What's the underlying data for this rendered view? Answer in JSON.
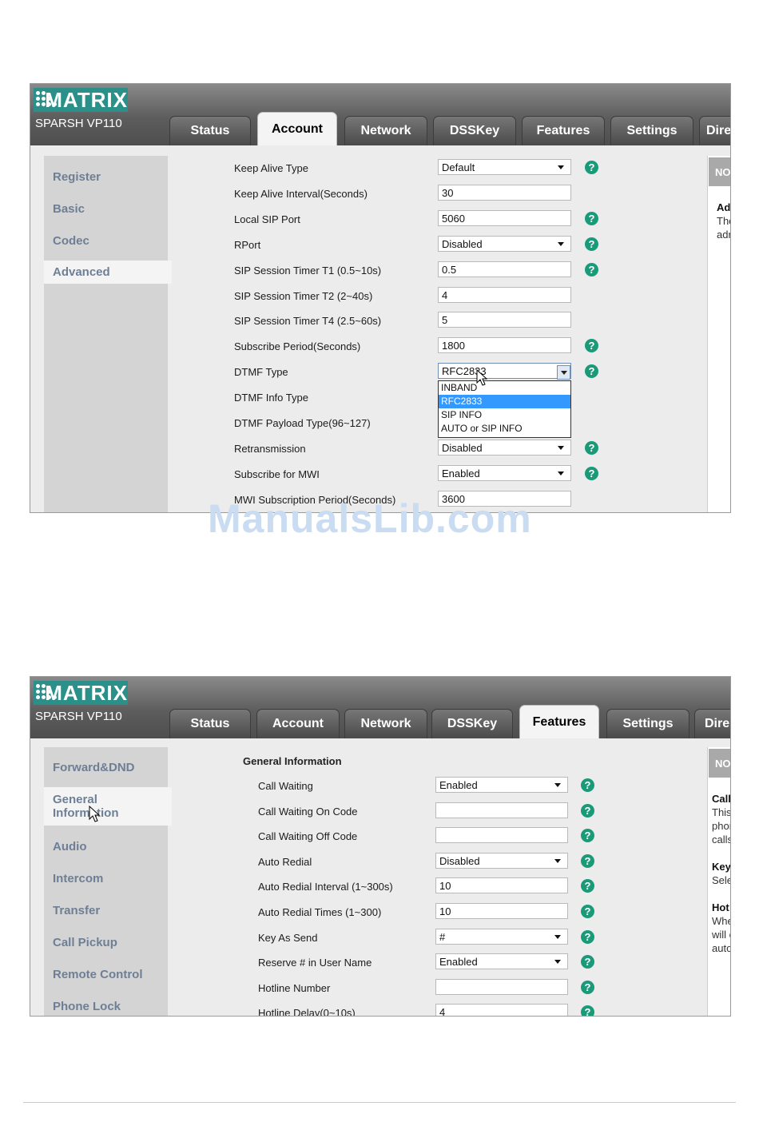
{
  "screen1": {
    "brand": "MATRIX",
    "model": "SPARSH VP110",
    "tabs": [
      "Status",
      "Account",
      "Network",
      "DSSKey",
      "Features",
      "Settings",
      "Dire"
    ],
    "active_tab": "Account",
    "sidebar": [
      "Register",
      "Basic",
      "Codec",
      "Advanced"
    ],
    "active_sidebar": "Advanced",
    "fields": [
      {
        "label": "Keep Alive Type",
        "value": "Default",
        "type": "select",
        "help": true
      },
      {
        "label": "Keep Alive Interval(Seconds)",
        "value": "30",
        "type": "input",
        "help": false
      },
      {
        "label": "Local SIP Port",
        "value": "5060",
        "type": "input",
        "help": true
      },
      {
        "label": "RPort",
        "value": "Disabled",
        "type": "select",
        "help": true
      },
      {
        "label": "SIP Session Timer T1 (0.5~10s)",
        "value": "0.5",
        "type": "input",
        "help": true
      },
      {
        "label": "SIP Session Timer T2 (2~40s)",
        "value": "4",
        "type": "input",
        "help": false
      },
      {
        "label": "SIP Session Timer T4 (2.5~60s)",
        "value": "5",
        "type": "input",
        "help": false
      },
      {
        "label": "Subscribe Period(Seconds)",
        "value": "1800",
        "type": "input",
        "help": true
      },
      {
        "label": "DTMF Type",
        "value": "RFC2833",
        "type": "open-select",
        "help": true
      },
      {
        "label": "DTMF Info Type",
        "value": "",
        "type": "hidden",
        "help": false
      },
      {
        "label": "DTMF Payload Type(96~127)",
        "value": "",
        "type": "hidden",
        "help": false
      },
      {
        "label": "Retransmission",
        "value": "Disabled",
        "type": "select",
        "help": true
      },
      {
        "label": "Subscribe for MWI",
        "value": "Enabled",
        "type": "select",
        "help": true
      },
      {
        "label": "MWI Subscription Period(Seconds)",
        "value": "3600",
        "type": "input",
        "help": false
      }
    ],
    "dtmf_options": [
      "INBAND",
      "RFC2833",
      "SIP INFO",
      "AUTO or SIP INFO"
    ],
    "dtmf_highlight": "RFC2833",
    "right_panel": {
      "head": "NO",
      "lines": [
        "Ad",
        "The",
        "adr"
      ]
    }
  },
  "screen2": {
    "brand": "MATRIX",
    "model": "SPARSH VP110",
    "tabs": [
      "Status",
      "Account",
      "Network",
      "DSSKey",
      "Features",
      "Settings",
      "Dire"
    ],
    "active_tab": "Features",
    "sidebar": [
      "Forward&DND",
      "General Information",
      "Audio",
      "Intercom",
      "Transfer",
      "Call Pickup",
      "Remote Control",
      "Phone Lock"
    ],
    "sidebar_general_lines": [
      "General",
      "Information"
    ],
    "active_sidebar": "General Information",
    "section_title": "General Information",
    "fields": [
      {
        "label": "Call Waiting",
        "value": "Enabled",
        "type": "select"
      },
      {
        "label": "Call Waiting On Code",
        "value": "",
        "type": "input"
      },
      {
        "label": "Call Waiting Off Code",
        "value": "",
        "type": "input"
      },
      {
        "label": "Auto Redial",
        "value": "Disabled",
        "type": "select"
      },
      {
        "label": "Auto Redial Interval (1~300s)",
        "value": "10",
        "type": "input"
      },
      {
        "label": "Auto Redial Times (1~300)",
        "value": "10",
        "type": "input"
      },
      {
        "label": "Key As Send",
        "value": "#",
        "type": "select"
      },
      {
        "label": "Reserve # in User Name",
        "value": "Enabled",
        "type": "select"
      },
      {
        "label": "Hotline Number",
        "value": "",
        "type": "input"
      },
      {
        "label": "Hotline Delay(0~10s)",
        "value": "4",
        "type": "input"
      }
    ],
    "right_panel": {
      "head": "NO",
      "lines": [
        {
          "text": "Call",
          "bold": true
        },
        {
          "text": "This",
          "bold": false
        },
        {
          "text": "phon",
          "bold": false
        },
        {
          "text": "calls",
          "bold": false
        },
        {
          "text": "Key",
          "bold": true
        },
        {
          "text": "Sele",
          "bold": false
        },
        {
          "text": "Hot",
          "bold": true
        },
        {
          "text": "Whe",
          "bold": false
        },
        {
          "text": "will c",
          "bold": false
        },
        {
          "text": "auto",
          "bold": false
        }
      ]
    }
  },
  "watermark": "ManualsLib.com",
  "colors": {
    "help": "#1a9a79",
    "logo": "#2b8f8a",
    "highlight": "#3399ff",
    "sidebar_text": "#6e7f95"
  }
}
